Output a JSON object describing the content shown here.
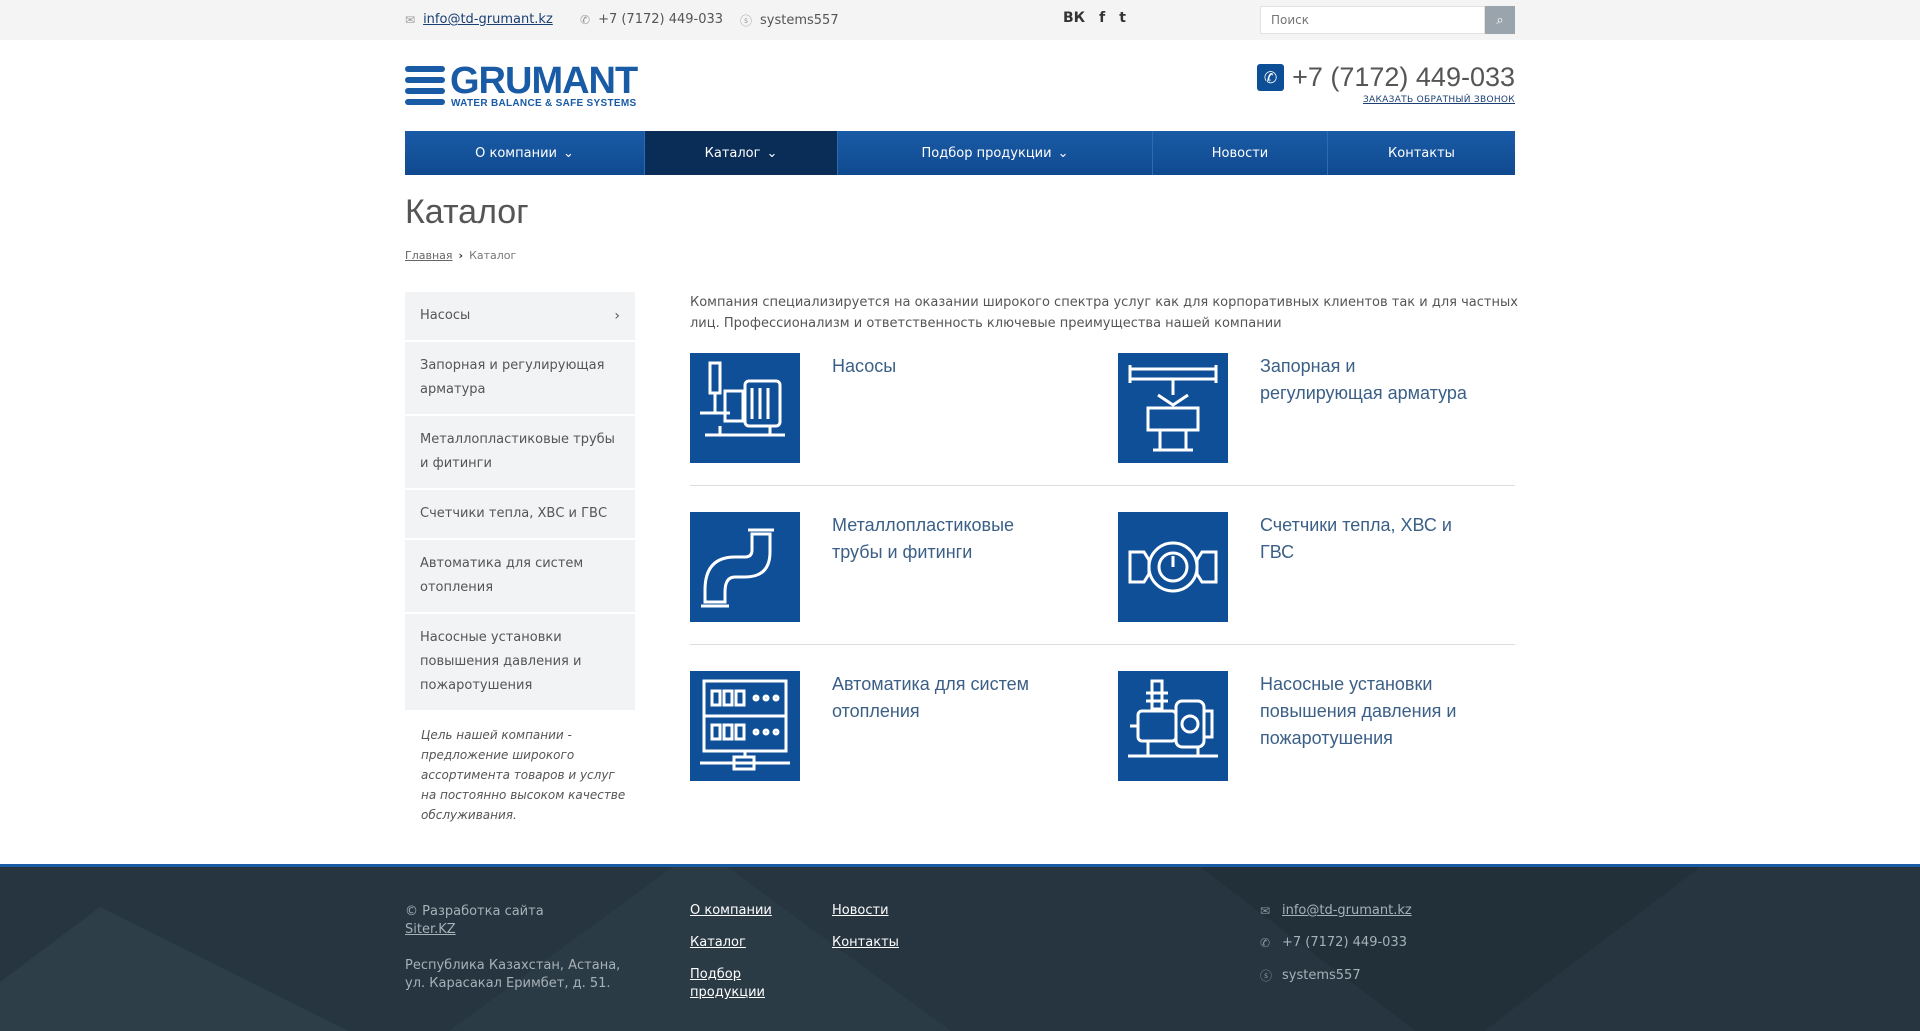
{
  "topbar": {
    "email": "info@td-grumant.kz",
    "phone": "+7 (7172) 449-033",
    "skype": "systems557",
    "social": [
      "ВК",
      "f",
      "t"
    ],
    "search_placeholder": "Поиск"
  },
  "logo": {
    "name": "GRUMANT",
    "tagline": "WATER BALANCE & SAFE SYSTEMS"
  },
  "header": {
    "phone": "+7 (7172) 449-033",
    "callback": "ЗАКАЗАТЬ ОБРАТНЫЙ ЗВОНОК"
  },
  "nav": [
    {
      "label": "О компании",
      "dropdown": true
    },
    {
      "label": "Каталог",
      "dropdown": true,
      "active": true
    },
    {
      "label": "Подбор продукции",
      "dropdown": true
    },
    {
      "label": "Новости",
      "dropdown": false
    },
    {
      "label": "Контакты",
      "dropdown": false
    }
  ],
  "page": {
    "title": "Каталог",
    "breadcrumb_home": "Главная",
    "breadcrumb_current": "Каталог"
  },
  "sidebar": {
    "items": [
      "Насосы",
      "Запорная и регулирующая арматура",
      "Металлопластиковые трубы и фитинги",
      "Счетчики тепла, ХВС и ГВС",
      "Автоматика для систем отопления",
      "Насосные установки повышения давления и пожаротушения"
    ],
    "quote": "Цель нашей компании - предложение широкого ассортимента товаров и услуг на постоянно высоком качестве обслуживания."
  },
  "intro": "Компания специализируется на оказании широкого спектра услуг как для корпоративных клиентов так и для частных лиц. Профессионализм и ответственность ключевые преимущества нашей компании",
  "categories": [
    {
      "label": "Насосы",
      "icon": "pump-icon"
    },
    {
      "label": "Запорная и регулирующая арматура",
      "icon": "valve-icon"
    },
    {
      "label": "Металлопластиковые трубы и фитинги",
      "icon": "pipe-icon"
    },
    {
      "label": "Счетчики тепла, ХВС и ГВС",
      "icon": "meter-icon"
    },
    {
      "label": "Автоматика для систем отопления",
      "icon": "automation-icon"
    },
    {
      "label": "Насосные установки повышения давления и пожаротушения",
      "icon": "pump-station-icon"
    }
  ],
  "footer": {
    "copyright": "© Разработка сайта",
    "dev_link": "Siter.KZ",
    "address": "Республика Казахстан, Астана, ул. Карасакал Еримбет, д. 51.",
    "links": [
      "О компании",
      "Каталог",
      "Подбор продукции",
      "Новости",
      "Контакты"
    ],
    "email": "info@td-grumant.kz",
    "phone": "+7 (7172) 449-033",
    "skype": "systems557"
  },
  "colors": {
    "brand": "#1a5ba6",
    "nav_active": "#0a2d57",
    "footer_bg": "#26353f",
    "tile": "#0f4f98"
  }
}
